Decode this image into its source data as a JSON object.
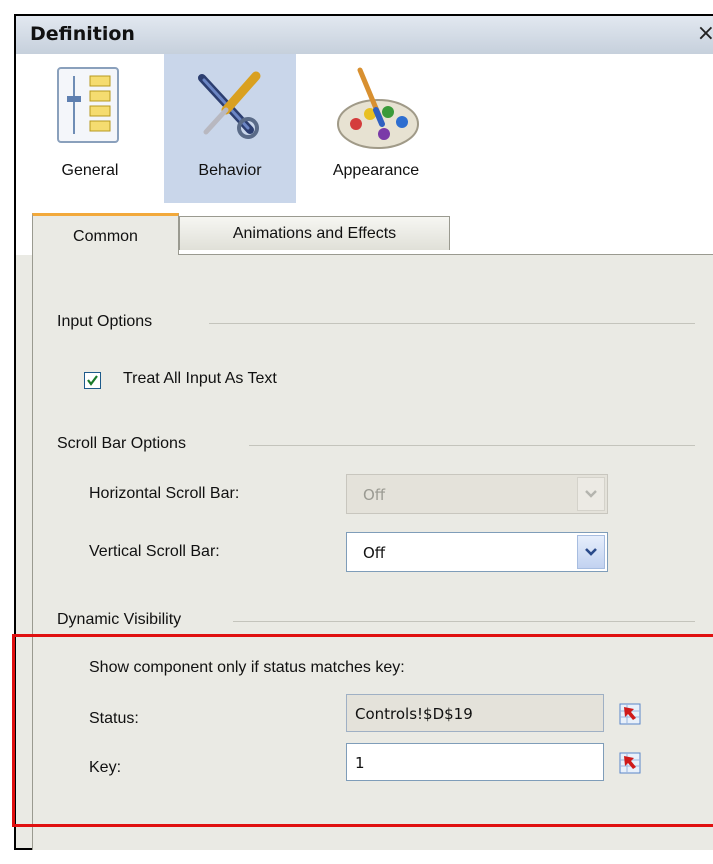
{
  "window": {
    "title": "Definition",
    "close_glyph": "×"
  },
  "toolbar": {
    "buttons": [
      {
        "label": "General",
        "icon": "general-settings-icon"
      },
      {
        "label": "Behavior",
        "icon": "wrench-screwdriver-icon",
        "active": true
      },
      {
        "label": "Appearance",
        "icon": "paint-palette-icon"
      }
    ]
  },
  "tabs": [
    {
      "label": "Common",
      "active": true
    },
    {
      "label": "Animations and Effects"
    }
  ],
  "input_options": {
    "heading": "Input Options",
    "treat_as_text": {
      "label": "Treat All Input As Text",
      "checked": true
    }
  },
  "scroll_bar_options": {
    "heading": "Scroll Bar Options",
    "horizontal": {
      "label": "Horizontal Scroll Bar:",
      "value": "Off",
      "disabled": true
    },
    "vertical": {
      "label": "Vertical Scroll Bar:",
      "value": "Off",
      "disabled": false
    }
  },
  "dynamic_visibility": {
    "heading": "Dynamic Visibility",
    "description": "Show component only if status matches key:",
    "status": {
      "label": "Status:",
      "value": "Controls!$D$19"
    },
    "key": {
      "label": "Key:",
      "value": "1"
    }
  },
  "colors": {
    "highlight_box": "#e01010",
    "tab_accent": "#f2a93b",
    "active_toolbar": "#c9d6ea"
  }
}
